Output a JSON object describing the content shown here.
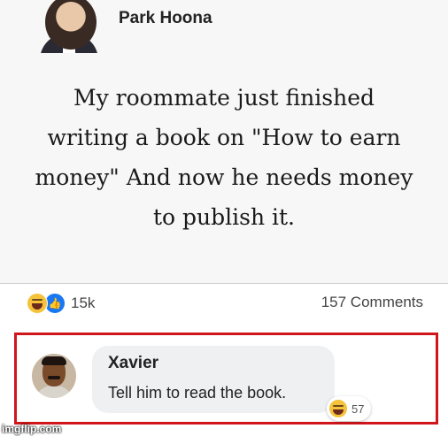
{
  "post": {
    "author": "Park Hoona",
    "text_lines": [
      "My roommate just finished",
      "writing a book on \"How to earn",
      "money\" And now he needs money",
      "to publish it."
    ],
    "reaction_count": "15k",
    "comments_count": "157 Comments",
    "reaction_icons": [
      "haha-icon",
      "like-icon"
    ]
  },
  "comment": {
    "author": "Xavier",
    "text": "Tell him to read the book.",
    "reaction_count": "57",
    "reaction_icon": "haha-icon"
  },
  "watermark": "imgflip.com",
  "colors": {
    "highlight_border": "#d0161a",
    "like_blue": "#1877f2",
    "bubble_bg": "#eef0f2"
  }
}
